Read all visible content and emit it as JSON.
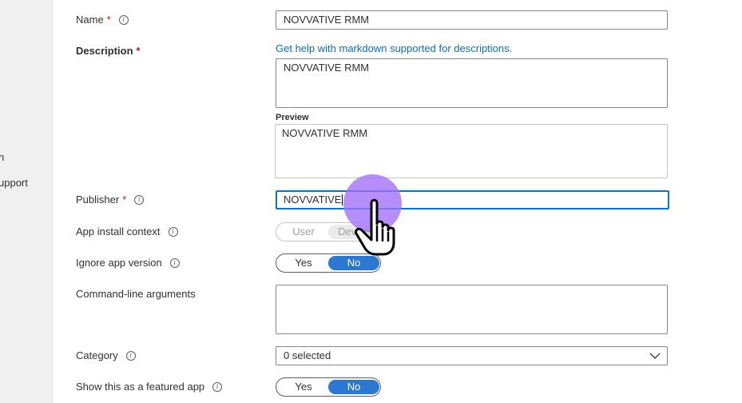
{
  "sidebar": {
    "items": [
      {
        "label": "n"
      },
      {
        "label": "upport"
      }
    ]
  },
  "form": {
    "name": {
      "label": "Name",
      "value": "NOVVATIVE RMM"
    },
    "description": {
      "label": "Description",
      "help_link": "Get help with markdown supported for descriptions.",
      "value": "NOVVATIVE RMM",
      "preview_label": "Preview",
      "preview_value": "NOVVATIVE RMM"
    },
    "publisher": {
      "label": "Publisher",
      "value": "NOVVATIVE"
    },
    "app_install_context": {
      "label": "App install context",
      "options": [
        "User",
        "Device"
      ],
      "selected": "Device",
      "disabled": true
    },
    "ignore_app_version": {
      "label": "Ignore app version",
      "options": [
        "Yes",
        "No"
      ],
      "selected": "No"
    },
    "command_line_arguments": {
      "label": "Command-line arguments",
      "value": ""
    },
    "category": {
      "label": "Category",
      "value": "0 selected"
    },
    "featured_app": {
      "label": "Show this as a featured app",
      "options": [
        "Yes",
        "No"
      ],
      "selected": "No"
    }
  },
  "required_marker": "*",
  "info_glyph": "i",
  "colors": {
    "accent": "#0078d4",
    "toggle_selected": "#2b78d4",
    "link": "#0f6cbd",
    "required": "#a4262c",
    "cursor_highlight": "#a06efa"
  },
  "icons": {
    "info": "info-icon",
    "chevron": "chevron-down-icon",
    "pointer": "hand-pointer-icon"
  }
}
